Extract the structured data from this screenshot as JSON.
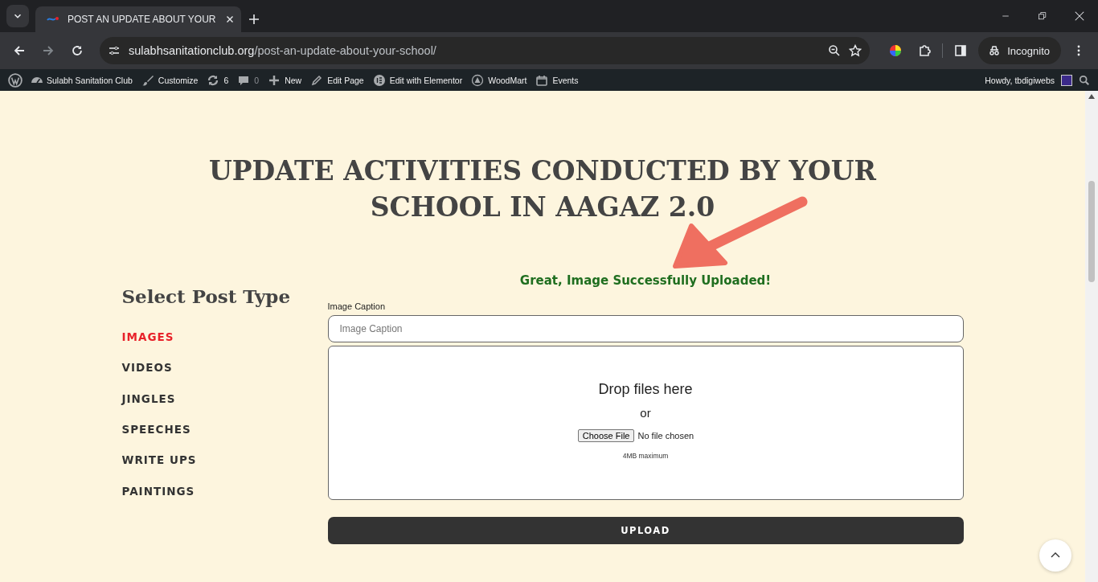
{
  "browser": {
    "tabs": [
      {
        "title": "POST AN UPDATE ABOUT YOUR",
        "selected": true
      }
    ],
    "url": {
      "host": "sulabhsanitationclub.org",
      "path": "/post-an-update-about-your-school/"
    },
    "profile": "Incognito"
  },
  "admin_bar": {
    "items": [
      {
        "kind": "wordpress"
      },
      {
        "kind": "dashboard",
        "label": "Sulabh Sanitation Club"
      },
      {
        "kind": "brush",
        "label": "Customize"
      },
      {
        "kind": "updates",
        "label": "6"
      },
      {
        "kind": "comments",
        "label": "0"
      },
      {
        "kind": "plus",
        "label": "New"
      },
      {
        "kind": "pencil",
        "label": "Edit Page"
      },
      {
        "kind": "elementor",
        "label": "Edit with Elementor"
      },
      {
        "kind": "woodmart",
        "label": "WoodMart"
      },
      {
        "kind": "calendar",
        "label": "Events"
      }
    ],
    "greeting": "Howdy, tbdigiwebs"
  },
  "page": {
    "heading": "UPDATE ACTIVITIES CONDUCTED BY YOUR SCHOOL IN AAGAZ 2.0",
    "sidebar": {
      "title": "Select Post Type",
      "items": [
        {
          "label": "IMAGES",
          "selected": true
        },
        {
          "label": "VIDEOS",
          "selected": false
        },
        {
          "label": "JINGLES",
          "selected": false
        },
        {
          "label": "SPEECHES",
          "selected": false
        },
        {
          "label": "WRITE UPS",
          "selected": false
        },
        {
          "label": "PAINTINGS",
          "selected": false
        }
      ]
    },
    "form": {
      "success": "Great, Image Successfully Uploaded!",
      "caption_label": "Image Caption",
      "caption_placeholder": "Image Caption",
      "dropzone": {
        "title": "Drop files here",
        "or": "or",
        "button": "Choose File",
        "status": "No file chosen",
        "note": "4MB maximum"
      },
      "submit": "UPLOAD"
    }
  }
}
